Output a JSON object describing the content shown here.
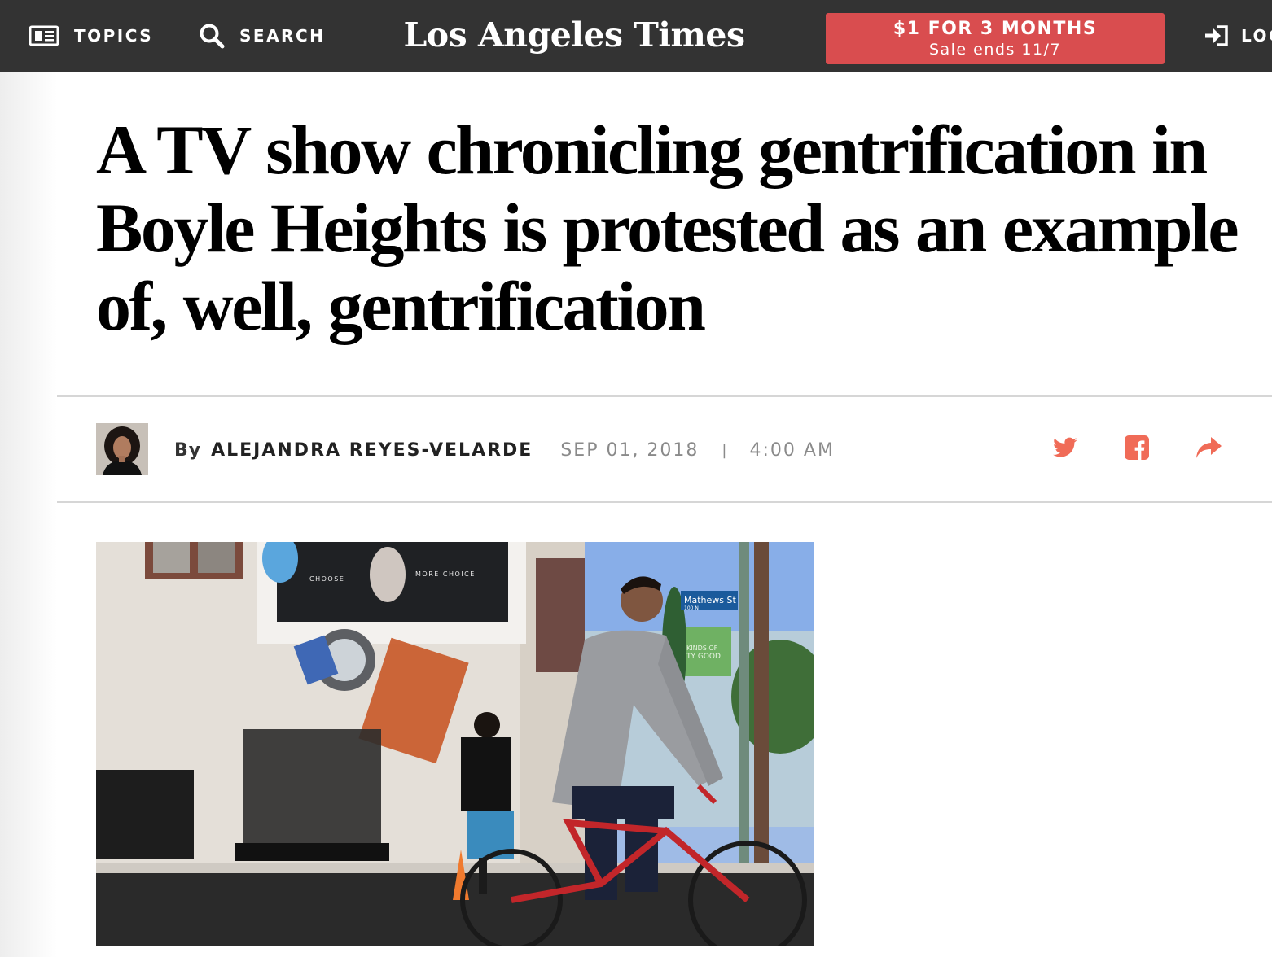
{
  "nav": {
    "topics_label": "TOPICS",
    "search_label": "SEARCH",
    "logo_text": "Los Angeles Times",
    "promo_main": "$1 FOR 3 MONTHS",
    "promo_sub": "Sale ends 11/7",
    "login_label": "LOG"
  },
  "article": {
    "headline": "A TV show chronicling gentrification in Boyle Heights is protested as an example of, well, gentrification",
    "byline_prefix": "By",
    "author": "ALEJANDRA REYES-VELARDE",
    "date": "SEP 01, 2018",
    "separator": "|",
    "time": "4:00 AM"
  },
  "photo": {
    "billboard_left": "CHOOSE",
    "billboard_right": "MORE CHOICE",
    "street_sign_name": "Mathews St",
    "street_sign_number": "100 N",
    "green_sign_line1": "KINDS OF",
    "green_sign_line2": "TY GOOD"
  },
  "colors": {
    "topbar": "#333333",
    "promo": "#d94d4f",
    "share_icons": "#f06b57"
  },
  "icons": {
    "topics": "newspaper-icon",
    "search": "search-icon",
    "login": "login-icon",
    "twitter": "twitter-icon",
    "facebook": "facebook-icon",
    "share": "share-icon"
  }
}
